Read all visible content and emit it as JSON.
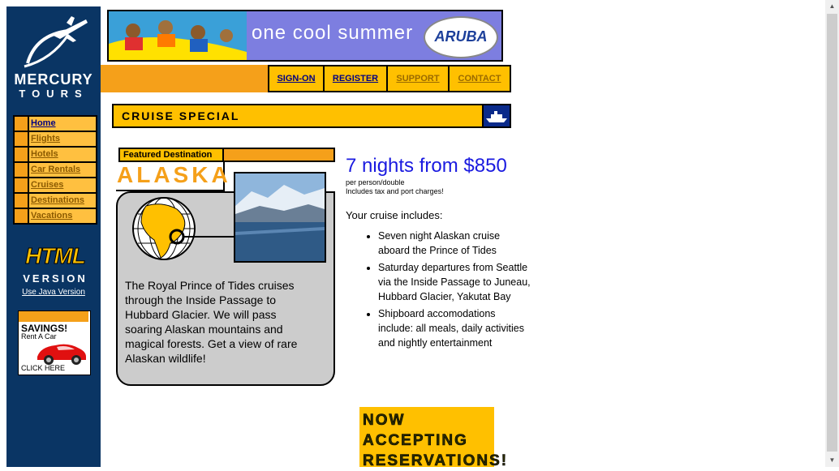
{
  "logo": {
    "name": "MERCURY",
    "sub": "TOURS"
  },
  "nav": {
    "items": [
      {
        "label": "Home"
      },
      {
        "label": "Flights"
      },
      {
        "label": "Hotels"
      },
      {
        "label": "Car Rentals"
      },
      {
        "label": "Cruises"
      },
      {
        "label": "Destinations"
      },
      {
        "label": "Vacations"
      }
    ]
  },
  "badge": {
    "html": "HTML",
    "version": "VERSION",
    "java_link": "Use Java Version"
  },
  "ad": {
    "savings": "SAVINGS!",
    "rent": "Rent A Car",
    "click": "CLICK HERE"
  },
  "banner": {
    "text": "one cool summer",
    "brand": "ARUBA"
  },
  "topnav": {
    "signon": "SIGN-ON",
    "register": "REGISTER",
    "support": "SUPPORT",
    "contact": "CONTACT"
  },
  "section": {
    "title": "CRUISE SPECIAL"
  },
  "featured": {
    "tab": "Featured Destination",
    "destination": "ALASKA",
    "description": "The Royal Prince of Tides cruises through the Inside Passage to Hubbard Glacier. We will pass soaring Alaskan mountains and magical forests. Get a view of rare Alaskan wildlife!"
  },
  "offer": {
    "price": "7 nights from $850",
    "per": "per person/double",
    "tax": "Includes tax and port charges!",
    "includes_heading": "Your cruise includes:",
    "bullets": [
      "Seven night Alaskan cruise aboard the Prince of Tides",
      "Saturday departures from Seattle via the Inside Passage to Juneau, Hubbard Glacier, Yakutat Bay",
      "Shipboard accomodations include: all meals, daily activities and nightly entertainment"
    ]
  },
  "reserve": {
    "line1": "NOW",
    "line2": "ACCEPTING",
    "line3": "RESERVATIONS!"
  },
  "colors": {
    "sidebar": "#0a3564",
    "orange": "#f5a01a",
    "gold": "#ffc000",
    "price_blue": "#1a1ae0"
  }
}
